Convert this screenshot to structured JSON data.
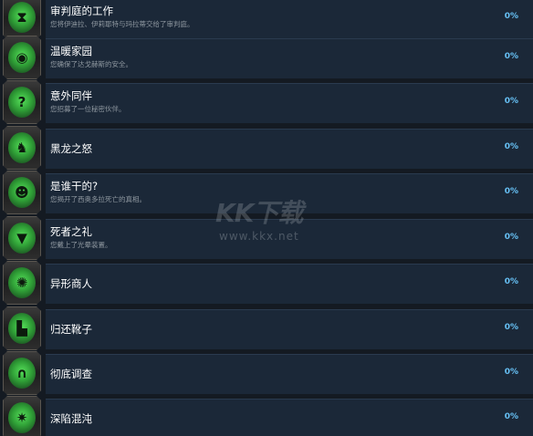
{
  "achievements": [
    {
      "icon": "judgement-hourglass-icon",
      "glyph": "⧗",
      "title": "审判庭的工作",
      "description": "您将伊迪拉、伊莉耶特与玛拉蒂交给了审判庭。",
      "progress": "0%"
    },
    {
      "icon": "warm-home-mask-icon",
      "glyph": "◉",
      "title": "温暖家园",
      "description": "您确保了达戈赫斯的安全。",
      "progress": "0%"
    },
    {
      "icon": "hooded-question-icon",
      "glyph": "?",
      "title": "意外同伴",
      "description": "您招募了一位秘密伙伴。",
      "progress": "0%"
    },
    {
      "icon": "black-dragon-icon",
      "glyph": "♞",
      "title": "黑龙之怒",
      "description": "",
      "progress": "0%"
    },
    {
      "icon": "mystery-face-icon",
      "glyph": "☻",
      "title": "是谁干的?",
      "description": "您揭开了西奥多拉死亡的真相。",
      "progress": "0%"
    },
    {
      "icon": "fanged-maw-icon",
      "glyph": "▼",
      "title": "死者之礼",
      "description": "您戴上了光晕装置。",
      "progress": "0%"
    },
    {
      "icon": "alien-merchant-icon",
      "glyph": "✺",
      "title": "异形商人",
      "description": "",
      "progress": "0%"
    },
    {
      "icon": "boots-icon",
      "glyph": "▙",
      "title": "归还靴子",
      "description": "",
      "progress": "0%"
    },
    {
      "icon": "investigation-gate-icon",
      "glyph": "∩",
      "title": "彻底调查",
      "description": "",
      "progress": "0%"
    },
    {
      "icon": "chaos-star-icon",
      "glyph": "✷",
      "title": "深陷混沌",
      "description": "",
      "progress": "0%"
    }
  ],
  "watermark": {
    "logo": "KK下载",
    "url": "www.kkx.net"
  }
}
